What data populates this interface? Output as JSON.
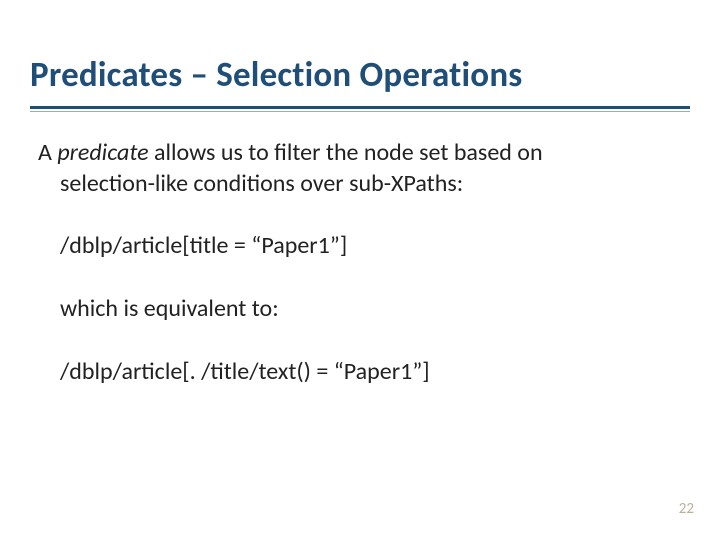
{
  "title": "Predicates – Selection Operations",
  "para": {
    "lead_a": "A ",
    "lead_predicate": "predicate",
    "lead_rest": "  allows us to filter the node set based on",
    "lead_line2": "selection-like conditions over sub-XPaths:",
    "code1": "/dblp/article[title = “Paper1”]",
    "equiv": "which is equivalent to:",
    "code2": "/dblp/article[. /title/text() = “Paper1”]"
  },
  "page_number": "22"
}
